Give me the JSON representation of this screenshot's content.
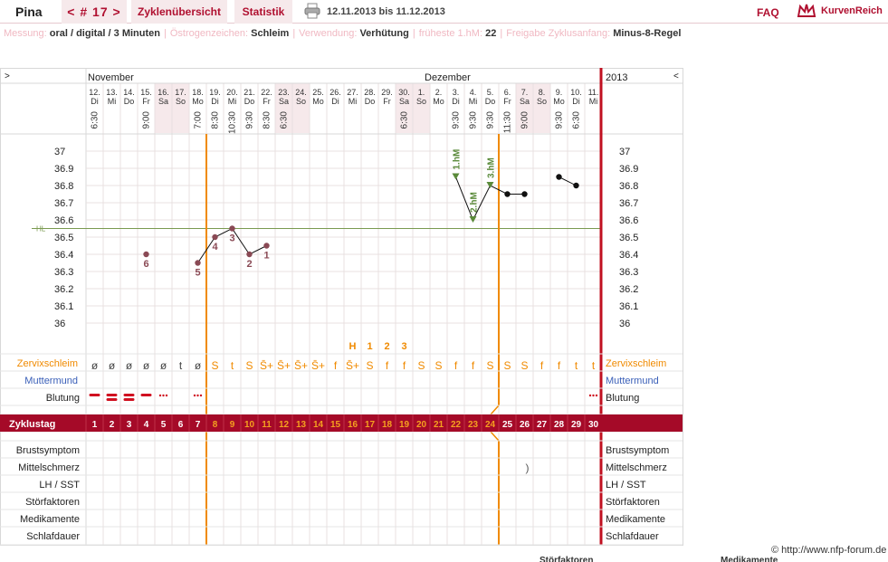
{
  "header": {
    "user_name": "Pina",
    "cycle_label": "< # 17 >",
    "tab_overview": "Zyklenübersicht",
    "tab_statistics": "Statistik",
    "date_range": "12.11.2013 bis 11.12.2013",
    "faq": "FAQ",
    "brand": "KurvenReich"
  },
  "meta": {
    "fields": [
      {
        "label": "Messung:",
        "value": "oral / digital / 3 Minuten"
      },
      {
        "label": "Östrogenzeichen:",
        "value": "Schleim"
      },
      {
        "label": "Verwendung:",
        "value": "Verhütung"
      },
      {
        "label": "früheste 1.hM:",
        "value": "22"
      },
      {
        "label": "Freigabe Zyklusanfang:",
        "value": "Minus-8-Regel"
      }
    ]
  },
  "nav": {
    "prev": ">",
    "next": "<"
  },
  "months": {
    "left": "November",
    "right": "Dezember",
    "year": "2013"
  },
  "days": [
    {
      "d": "12.",
      "w": "Di",
      "t": "6:30"
    },
    {
      "d": "13.",
      "w": "Mi",
      "t": ""
    },
    {
      "d": "14.",
      "w": "Do",
      "t": ""
    },
    {
      "d": "15.",
      "w": "Fr",
      "t": "9:00"
    },
    {
      "d": "16.",
      "w": "Sa",
      "t": "",
      "we": true
    },
    {
      "d": "17.",
      "w": "So",
      "t": "",
      "we": true
    },
    {
      "d": "18.",
      "w": "Mo",
      "t": "7:00"
    },
    {
      "d": "19.",
      "w": "Di",
      "t": "8:30"
    },
    {
      "d": "20.",
      "w": "Mi",
      "t": "10:30"
    },
    {
      "d": "21.",
      "w": "Do",
      "t": "9:30"
    },
    {
      "d": "22.",
      "w": "Fr",
      "t": "8:30"
    },
    {
      "d": "23.",
      "w": "Sa",
      "t": "6:30",
      "we": true
    },
    {
      "d": "24.",
      "w": "So",
      "t": "",
      "we": true
    },
    {
      "d": "25.",
      "w": "Mo",
      "t": ""
    },
    {
      "d": "26.",
      "w": "Di",
      "t": ""
    },
    {
      "d": "27.",
      "w": "Mi",
      "t": ""
    },
    {
      "d": "28.",
      "w": "Do",
      "t": ""
    },
    {
      "d": "29.",
      "w": "Fr",
      "t": ""
    },
    {
      "d": "30.",
      "w": "Sa",
      "t": "6:30",
      "we": true
    },
    {
      "d": "1.",
      "w": "So",
      "t": "",
      "we": true
    },
    {
      "d": "2.",
      "w": "Mo",
      "t": ""
    },
    {
      "d": "3.",
      "w": "Di",
      "t": "9:30"
    },
    {
      "d": "4.",
      "w": "Mi",
      "t": "9:30"
    },
    {
      "d": "5.",
      "w": "Do",
      "t": "9:30"
    },
    {
      "d": "6.",
      "w": "Fr",
      "t": "11:30"
    },
    {
      "d": "7.",
      "w": "Sa",
      "t": "9:00",
      "we": true
    },
    {
      "d": "8.",
      "w": "So",
      "t": "",
      "we": true
    },
    {
      "d": "9.",
      "w": "Mo",
      "t": "9:30"
    },
    {
      "d": "10.",
      "w": "Di",
      "t": "6:30"
    },
    {
      "d": "11.",
      "w": "Mi",
      "t": ""
    }
  ],
  "temperature": {
    "axis": [
      "37",
      "36.9",
      "36.8",
      "36.7",
      "36.6",
      "36.5",
      "36.4",
      "36.3",
      "36.2",
      "36.1",
      "36"
    ],
    "hl_label": "HL",
    "hl_value": 36.55,
    "values": [
      null,
      null,
      null,
      36.4,
      null,
      null,
      36.35,
      36.5,
      36.55,
      36.4,
      36.45,
      null,
      null,
      null,
      null,
      null,
      null,
      null,
      null,
      null,
      null,
      36.85,
      36.6,
      36.8,
      36.75,
      36.75,
      null,
      36.85,
      36.8,
      null
    ],
    "count_labels": [
      {
        "day": 4,
        "text": "6"
      },
      {
        "day": 7,
        "text": "5"
      },
      {
        "day": 8,
        "text": "4"
      },
      {
        "day": 9,
        "text": "3"
      },
      {
        "day": 10,
        "text": "2"
      },
      {
        "day": 11,
        "text": "1"
      }
    ],
    "hm_labels": [
      {
        "day": 22,
        "text": "1.hM"
      },
      {
        "day": 23,
        "text": "2.hM"
      },
      {
        "day": 24,
        "text": "3.hM"
      }
    ],
    "segments": [
      [
        3,
        3
      ],
      [
        6,
        10
      ],
      [
        21,
        25
      ],
      [
        27,
        28
      ]
    ]
  },
  "mucus_peak": {
    "H": "H",
    "counts": [
      "1",
      "2",
      "3"
    ]
  },
  "rows": {
    "zervix": "Zervixschleim",
    "muttermund": "Muttermund",
    "blutung": "Blutung",
    "zyklustag": "Zyklustag",
    "brust": "Brustsymptom",
    "mittelschmerz": "Mittelschmerz",
    "lh": "LH / SST",
    "stoer": "Störfaktoren",
    "medi": "Medikamente",
    "schlaf": "Schlafdauer"
  },
  "mucus": [
    "ø",
    "ø",
    "ø",
    "ø",
    "ø",
    "t",
    "ø",
    "S",
    "t",
    "S",
    "S̄+",
    "S̄+",
    "S̄+",
    "S̄+",
    "f",
    "S̄+",
    "S",
    "f",
    "f",
    "S",
    "S",
    "f",
    "f",
    "S",
    "S",
    "S",
    "f",
    "f",
    "t",
    "t"
  ],
  "bleeding": [
    "heavy",
    "very-heavy",
    "very-heavy",
    "heavy",
    "light",
    "",
    "light",
    "",
    "",
    "",
    "",
    "",
    "",
    "",
    "",
    "",
    "",
    "",
    "",
    "",
    "",
    "",
    "",
    "",
    "",
    "",
    "",
    "",
    "",
    "light"
  ],
  "mittelschmerz_mark": {
    "day": 26,
    "symbol": ")"
  },
  "cycle_days": [
    "1",
    "2",
    "3",
    "4",
    "5",
    "6",
    "7",
    "8",
    "9",
    "10",
    "11",
    "12",
    "13",
    "14",
    "15",
    "16",
    "17",
    "18",
    "19",
    "20",
    "21",
    "22",
    "23",
    "24",
    "25",
    "26",
    "27",
    "28",
    "29",
    "30"
  ],
  "footer": {
    "credit": "© http://www.nfp-forum.de",
    "cut_left": "Störfaktoren",
    "cut_right": "Medikamente"
  },
  "colors": {
    "accent": "#b01030",
    "orange": "#f08a00",
    "weekend": "#f6e9eb",
    "grid": "#e8e0e0",
    "muttermund": "#3a5fb8",
    "marker_green": "#5a8a3a",
    "point": "#8a4a55"
  }
}
